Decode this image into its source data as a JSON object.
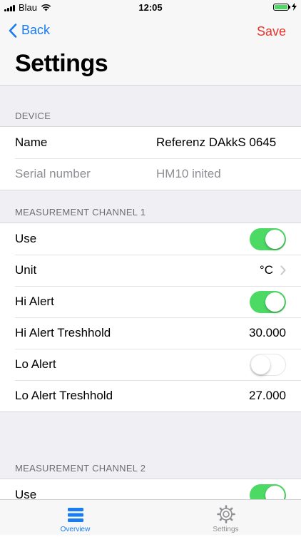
{
  "status": {
    "carrier": "Blau",
    "time": "12:05"
  },
  "nav": {
    "back_label": "Back",
    "save_label": "Save",
    "title": "Settings"
  },
  "device": {
    "header": "DEVICE",
    "name_label": "Name",
    "name_value": "Referenz DAkkS 0645",
    "serial_label": "Serial number",
    "serial_value": "HM10 inited"
  },
  "channel1": {
    "header": "MEASUREMENT CHANNEL 1",
    "use_label": "Use",
    "use_on": true,
    "unit_label": "Unit",
    "unit_value": "°C",
    "hi_alert_label": "Hi Alert",
    "hi_alert_on": true,
    "hi_threshold_label": "Hi Alert Treshhold",
    "hi_threshold_value": "30.000",
    "lo_alert_label": "Lo Alert",
    "lo_alert_on": false,
    "lo_threshold_label": "Lo Alert Treshhold",
    "lo_threshold_value": "27.000"
  },
  "channel2": {
    "header": "MEASUREMENT CHANNEL 2",
    "use_label": "Use",
    "use_on": true
  },
  "tabs": [
    {
      "label": "Overview",
      "icon": "overview-stack-icon",
      "active": true
    },
    {
      "label": "Settings",
      "icon": "gear-icon",
      "active": false
    }
  ],
  "colors": {
    "accent": "#1a7cf0",
    "save": "#e8352b",
    "switch_on": "#4cd964"
  }
}
